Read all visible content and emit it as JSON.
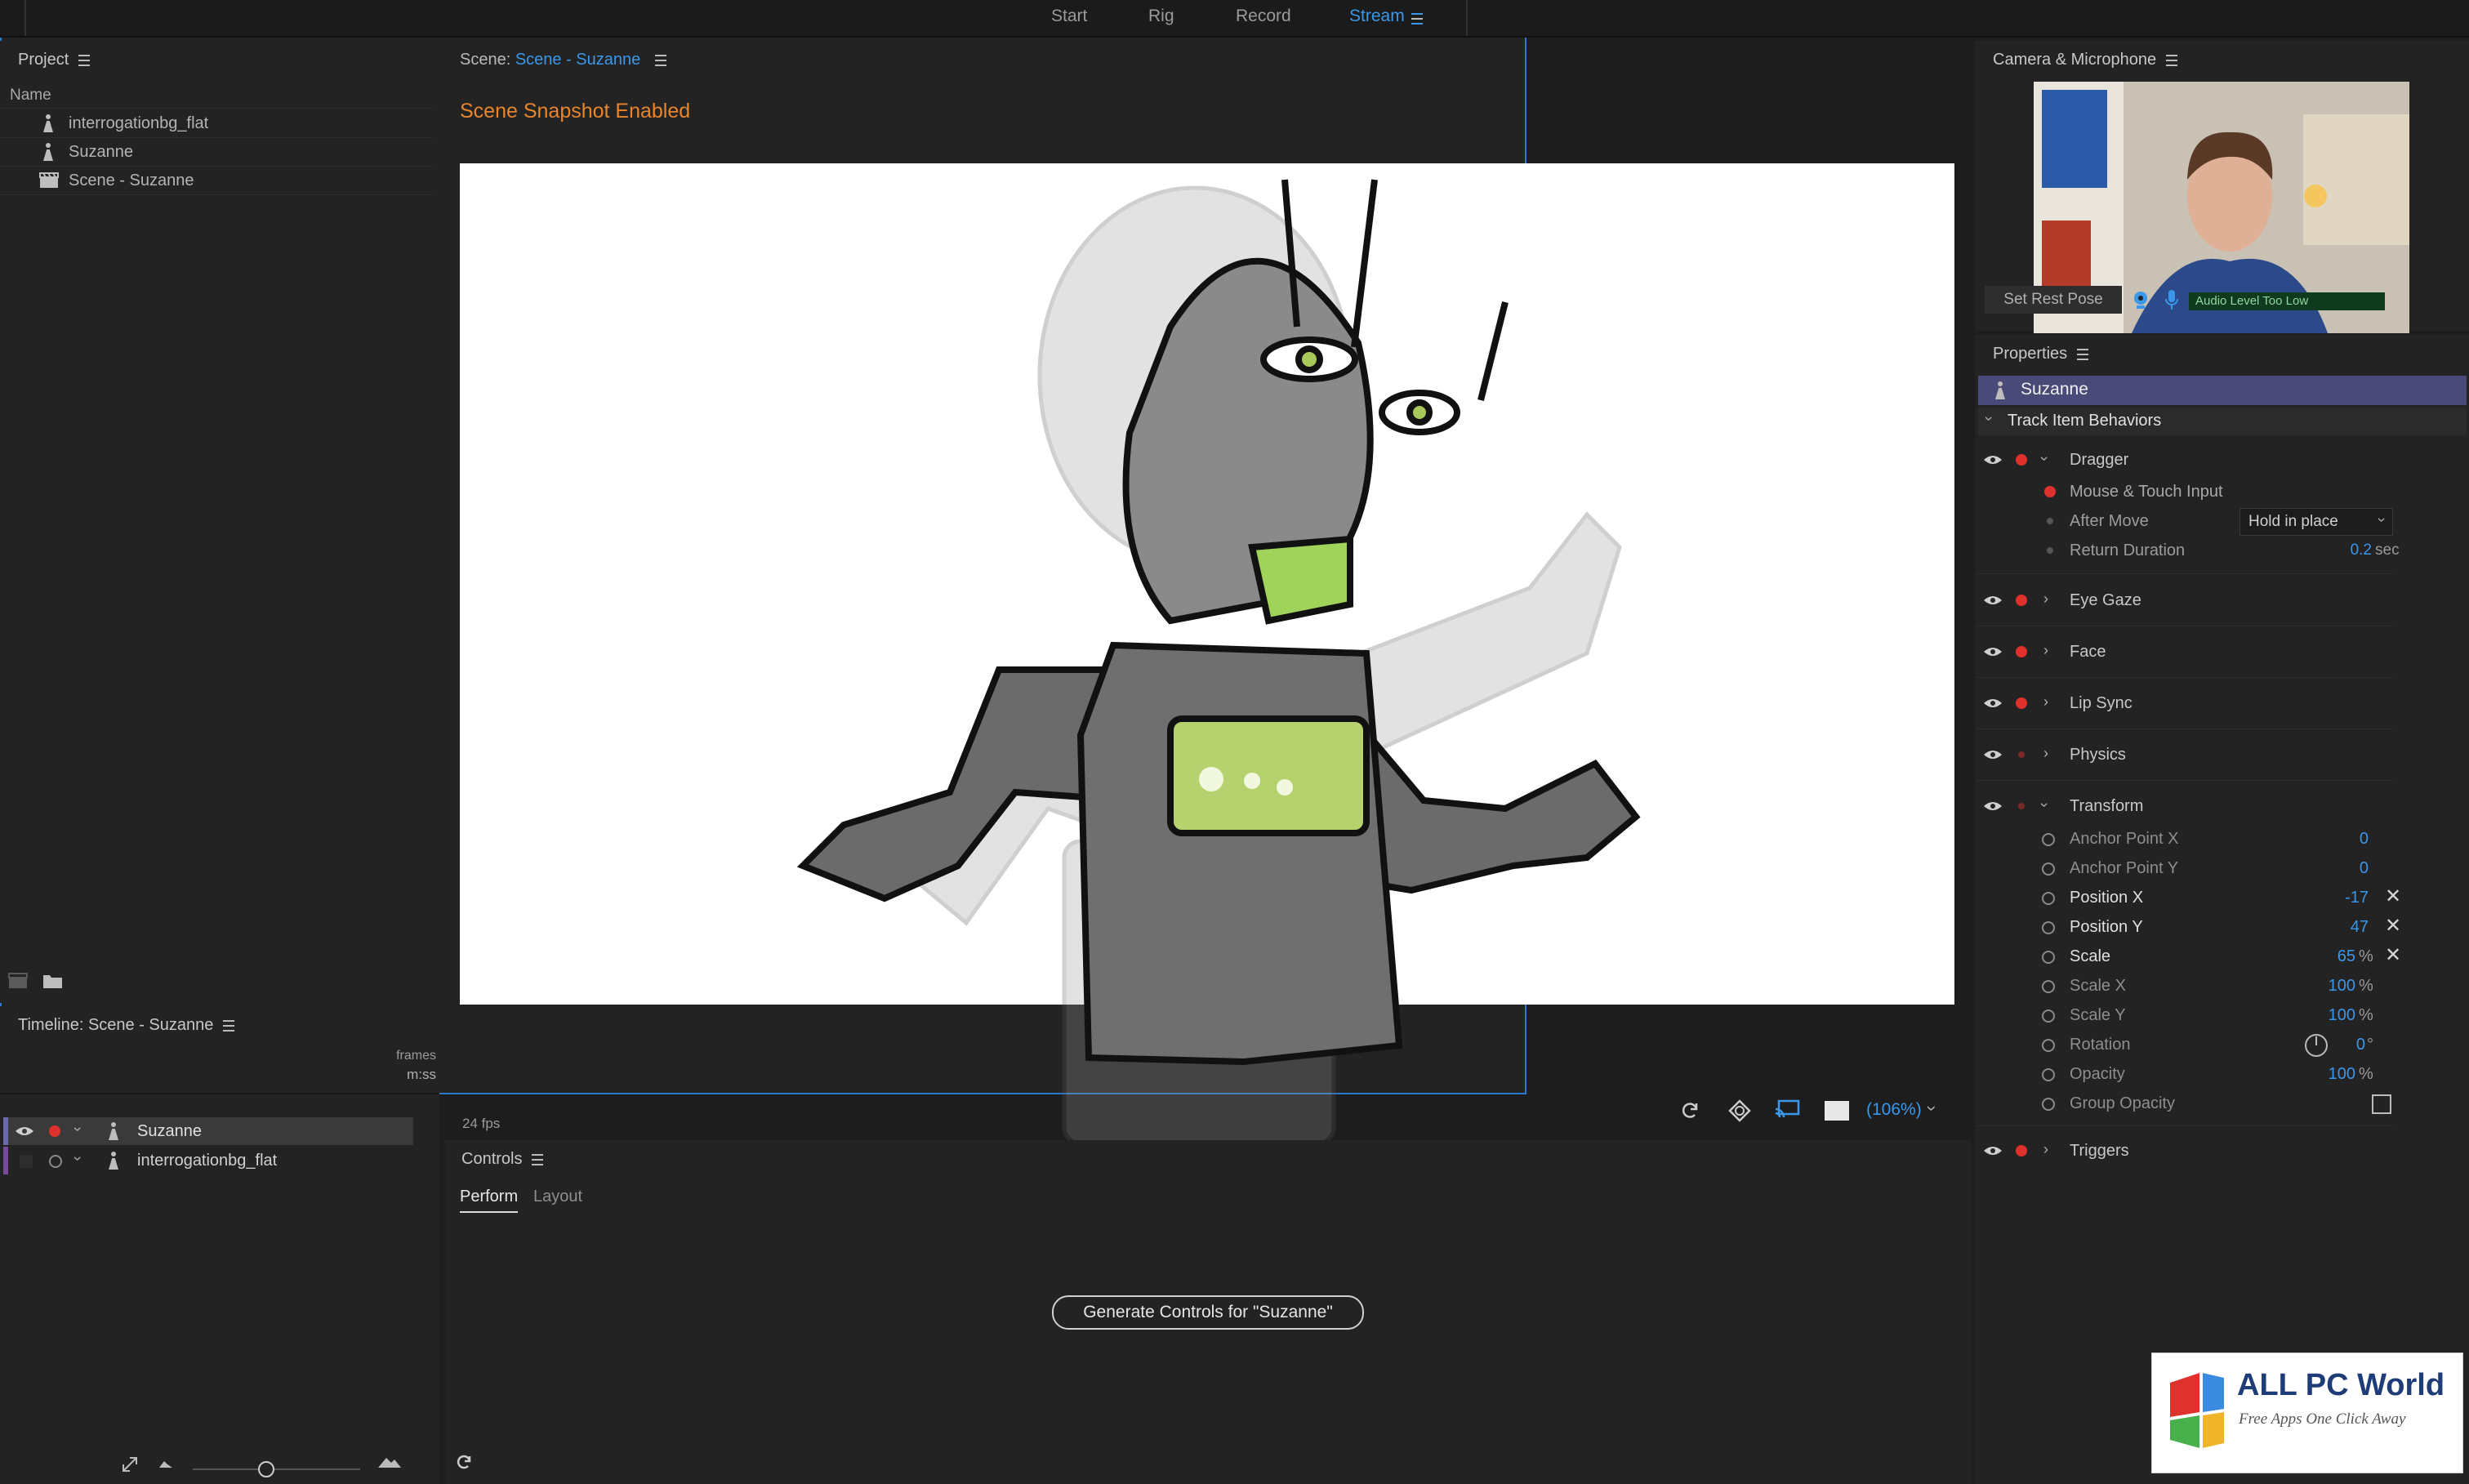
{
  "workspaces": [
    "Start",
    "Rig",
    "Record",
    "Stream"
  ],
  "active_workspace": "Stream",
  "project": {
    "title": "Project",
    "column_name": "Name",
    "items": [
      {
        "label": "interrogationbg_flat",
        "icon": "puppet-icon"
      },
      {
        "label": "Suzanne",
        "icon": "puppet-icon"
      },
      {
        "label": "Scene - Suzanne",
        "icon": "scene-clapper-icon"
      }
    ]
  },
  "timeline": {
    "title": "Timeline: Scene - Suzanne",
    "units": [
      "frames",
      "m:ss"
    ],
    "tracks": [
      {
        "label": "Suzanne",
        "selected": true
      },
      {
        "label": "interrogationbg_flat",
        "selected": false
      }
    ]
  },
  "scene": {
    "prefix": "Scene:",
    "name": "Scene - Suzanne",
    "snapshot_msg": "Scene Snapshot Enabled",
    "fps": "24 fps",
    "zoom": "(106%)"
  },
  "controls": {
    "title": "Controls",
    "tabs": [
      "Perform",
      "Layout"
    ],
    "generate_label": "Generate Controls for \"Suzanne\""
  },
  "camera": {
    "title": "Camera & Microphone",
    "set_rest_pose": "Set Rest Pose",
    "audio_status": "Audio Level Too Low"
  },
  "properties": {
    "title": "Properties",
    "puppet_name": "Suzanne",
    "section": "Track Item Behaviors",
    "dragger": {
      "name": "Dragger",
      "mouse_touch": "Mouse & Touch Input",
      "after_move_label": "After Move",
      "after_move_value": "Hold in place",
      "return_duration_label": "Return Duration",
      "return_duration_value": "0.2",
      "return_duration_unit": "sec"
    },
    "behaviors": [
      "Eye Gaze",
      "Face",
      "Lip Sync",
      "Physics"
    ],
    "transform": {
      "name": "Transform",
      "params": [
        {
          "label": "Anchor Point X",
          "value": "0",
          "unit": "",
          "x": false
        },
        {
          "label": "Anchor Point Y",
          "value": "0",
          "unit": "",
          "x": false
        },
        {
          "label": "Position X",
          "value": "-17",
          "unit": "",
          "x": true
        },
        {
          "label": "Position Y",
          "value": "47",
          "unit": "",
          "x": true
        },
        {
          "label": "Scale",
          "value": "65",
          "unit": "%",
          "x": true
        },
        {
          "label": "Scale X",
          "value": "100",
          "unit": "%",
          "x": false
        },
        {
          "label": "Scale Y",
          "value": "100",
          "unit": "%",
          "x": false
        },
        {
          "label": "Rotation",
          "value": "0",
          "unit": "°",
          "x": false
        },
        {
          "label": "Opacity",
          "value": "100",
          "unit": "%",
          "x": false
        },
        {
          "label": "Group Opacity",
          "value": "",
          "unit": "",
          "x": false
        }
      ]
    },
    "triggers": "Triggers"
  },
  "watermark": {
    "title": "ALL PC World",
    "tagline": "Free Apps One Click Away"
  },
  "colors": {
    "accent_blue": "#3a97ea",
    "orange": "#e8852c",
    "record_red": "#e0302c",
    "selection_purple": "#4a4a78"
  }
}
